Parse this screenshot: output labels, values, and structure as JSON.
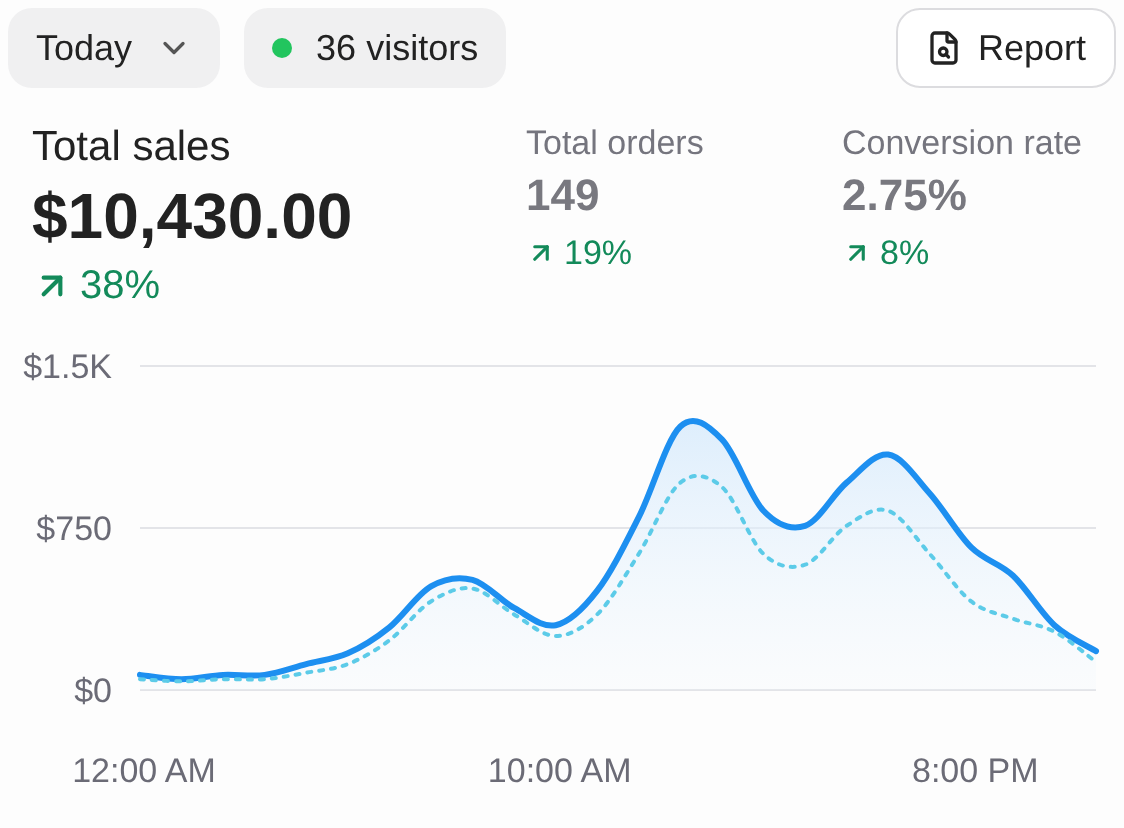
{
  "toolbar": {
    "period": {
      "label": "Today"
    },
    "visitors": {
      "label": "36 visitors",
      "color": "#22c55e"
    },
    "report": {
      "label": "Report"
    }
  },
  "metrics": [
    {
      "kind": "primary",
      "label": "Total sales",
      "value": "$10,430.00",
      "change": "38%"
    },
    {
      "kind": "secondary",
      "label": "Total orders",
      "value": "149",
      "change": "19%"
    },
    {
      "kind": "secondary",
      "label": "Conversion rate",
      "value": "2.75%",
      "change": "8%"
    }
  ],
  "chart_data": {
    "type": "area",
    "x": [
      0,
      1,
      2,
      3,
      4,
      5,
      6,
      7,
      8,
      9,
      10,
      11,
      12,
      13,
      14,
      15,
      16,
      17,
      18,
      19,
      20,
      21,
      22,
      23
    ],
    "xlim": [
      0,
      23
    ],
    "ylim": [
      0,
      1500
    ],
    "yticks": [
      {
        "value": 0,
        "label": "$0"
      },
      {
        "value": 750,
        "label": "$750"
      },
      {
        "value": 1500,
        "label": "$1.5K"
      }
    ],
    "xticks": [
      {
        "value": 0,
        "label": "12:00 AM"
      },
      {
        "value": 10,
        "label": "10:00 AM"
      },
      {
        "value": 20,
        "label": "8:00 PM"
      }
    ],
    "series": [
      {
        "type": "area",
        "color": "#1d8ff0",
        "line_style": "solid",
        "values": [
          70,
          50,
          70,
          70,
          120,
          170,
          290,
          480,
          510,
          380,
          300,
          460,
          800,
          1220,
          1160,
          830,
          760,
          960,
          1090,
          910,
          660,
          530,
          300,
          180
        ]
      },
      {
        "type": "line",
        "color": "#5ccbe8",
        "line_style": "dotted",
        "values": [
          50,
          40,
          50,
          50,
          80,
          120,
          230,
          410,
          470,
          350,
          250,
          350,
          630,
          960,
          940,
          630,
          580,
          760,
          830,
          630,
          410,
          330,
          270,
          130
        ]
      }
    ]
  }
}
